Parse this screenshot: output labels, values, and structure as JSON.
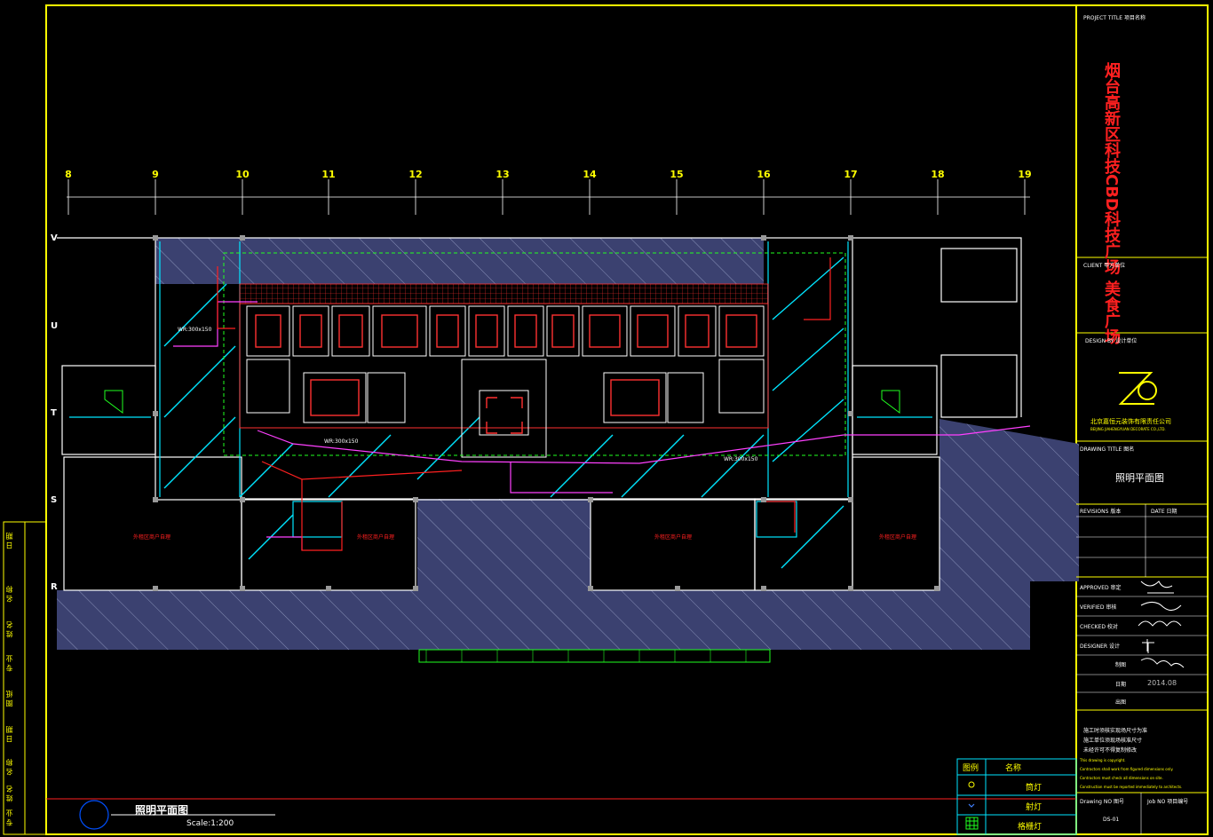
{
  "project": {
    "title_label": "PROJECT TITLE  项目名称",
    "title_line1": "烟台高新区科技CBD科技广场",
    "title_line2": "美食广场",
    "client_label": "CLIENT  甲方单位",
    "design_by_label": "DESIGN BY   设计单位",
    "company_cn": "北京嘉恒元装饰有限责任公司",
    "company_en": "BEIJING JIAHENGYUAN DECORATE CO.,LTD.",
    "drawing_title_label": "DRAWING TITLE  图名",
    "drawing_title": "照明平面图",
    "revisions_label": "REVISIONS  版本",
    "date_label": "DATE   日期",
    "approved_label": "APPROVED  审定",
    "verified_label": "VERIFIED  审核",
    "checked_label": "CHECKED  校对",
    "designer_label": "DESIGNER  设计",
    "drawn_label": "制图",
    "date2_label": "日期",
    "date2_value": "2014.08",
    "issue_label": "出图",
    "notes": [
      "施工时须核实现场尺寸为准",
      "施工单位须现场核准尺寸",
      "未经许可不得复制修改"
    ],
    "notes_en": [
      "This drawing is copyright.",
      "Contractors shall work from figured dimensions only.",
      "Contractors must check all dimensions on site.",
      "Construction must be reported immediately to architects."
    ],
    "drawing_no_label": "Drawing NO  图号",
    "job_no_label": "Job NO   项目编号",
    "drawing_no": "DS-01"
  },
  "plan": {
    "title": "照明平面图",
    "scale": "Scale:1:200",
    "grid_numbers": [
      "8",
      "9",
      "10",
      "11",
      "12",
      "13",
      "14",
      "15",
      "16",
      "17",
      "18",
      "19"
    ],
    "row_letters": [
      "V",
      "U",
      "T",
      "S",
      "R"
    ],
    "duct_labels": [
      "WR:300x150",
      "WR:300x150",
      "WR:300x150"
    ],
    "room_labels": [
      "外租区商户自理",
      "外租区商户自理",
      "外租区商户自理",
      "外租区商户自理"
    ]
  },
  "side_strip": [
    "日 期",
    "名 称",
    "姓 名",
    "专 业",
    "图 纸",
    "日 期",
    "名 称",
    "姓 名",
    "专 业"
  ],
  "legend": {
    "header_symbol": "图例",
    "header_name": "名称",
    "items": [
      {
        "symbol": "downlight-icon",
        "name": "筒灯"
      },
      {
        "symbol": "spotlight-icon",
        "name": "射灯"
      },
      {
        "symbol": "grille-light-icon",
        "name": "格栅灯"
      }
    ]
  },
  "colors": {
    "background": "#000000",
    "frame": "#ffff00",
    "hatch_fill": "#3b4170",
    "wall": "#ffffff",
    "cyan_line": "#00e5ff",
    "red_line": "#ff2020",
    "magenta_line": "#ff40ff",
    "green_line": "#20ff20",
    "title_red": "#ff2020"
  }
}
